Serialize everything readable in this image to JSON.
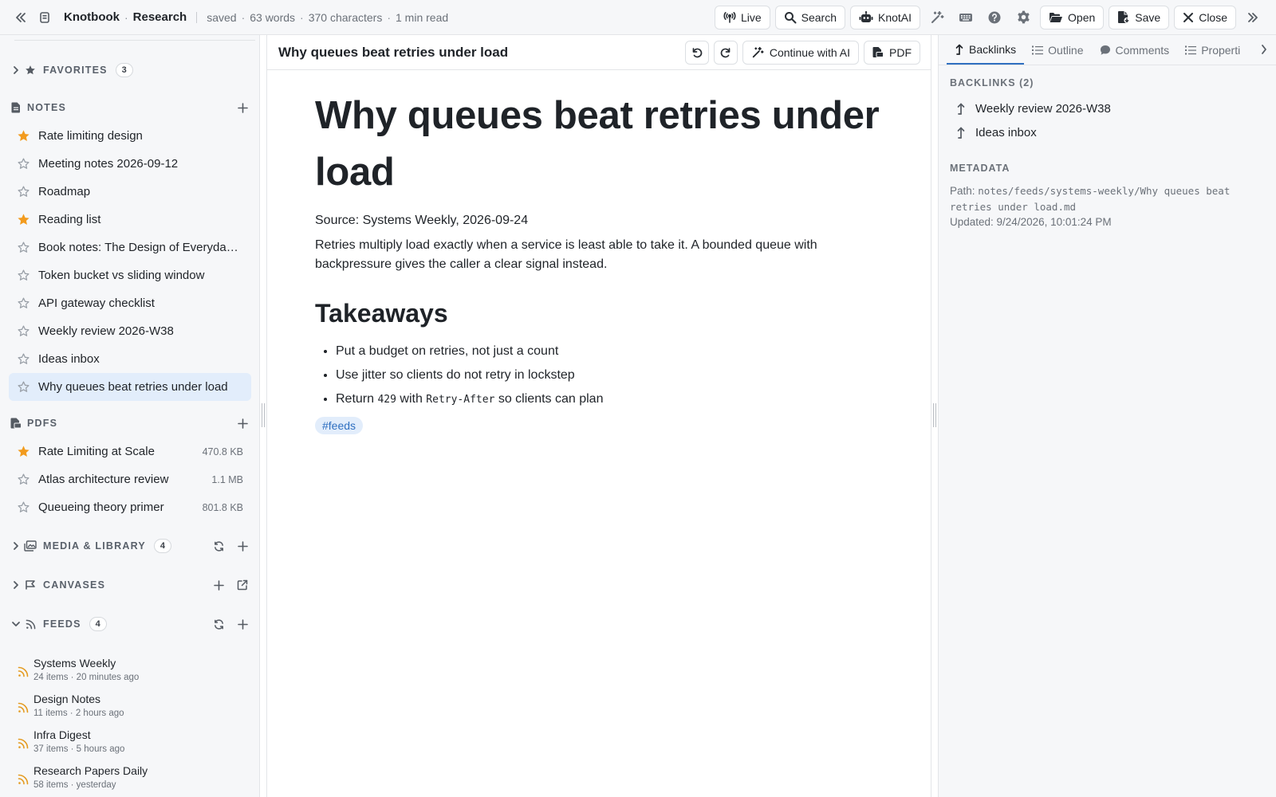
{
  "topbar": {
    "app_name": "Knotbook",
    "vault_name": "Research",
    "separator": "·",
    "save_status": "saved",
    "words": "63 words",
    "characters": "370 characters",
    "read_time": "1 min read",
    "buttons": {
      "live": "Live",
      "search": "Search",
      "knotai": "KnotAI",
      "open": "Open",
      "save": "Save",
      "close": "Close"
    }
  },
  "sidebar": {
    "favorites": {
      "title": "FAVORITES",
      "count": "3"
    },
    "notes": {
      "title": "NOTES",
      "items": [
        {
          "label": "Rate limiting design",
          "starred": true
        },
        {
          "label": "Meeting notes 2026-09-12",
          "starred": false
        },
        {
          "label": "Roadmap",
          "starred": false
        },
        {
          "label": "Reading list",
          "starred": true
        },
        {
          "label": "Book notes: The Design of Everyday ...",
          "starred": false
        },
        {
          "label": "Token bucket vs sliding window",
          "starred": false
        },
        {
          "label": "API gateway checklist",
          "starred": false
        },
        {
          "label": "Weekly review 2026-W38",
          "starred": false
        },
        {
          "label": "Ideas inbox",
          "starred": false
        },
        {
          "label": "Why queues beat retries under load",
          "starred": false,
          "active": true
        }
      ]
    },
    "pdfs": {
      "title": "PDFS",
      "items": [
        {
          "label": "Rate Limiting at Scale",
          "size": "470.8 KB",
          "starred": true
        },
        {
          "label": "Atlas architecture review",
          "size": "1.1 MB",
          "starred": false
        },
        {
          "label": "Queueing theory primer",
          "size": "801.8 KB",
          "starred": false
        }
      ]
    },
    "media": {
      "title": "MEDIA & LIBRARY",
      "count": "4"
    },
    "canvases": {
      "title": "CANVASES"
    },
    "feeds": {
      "title": "FEEDS",
      "count": "4",
      "items": [
        {
          "name": "Systems Weekly",
          "meta": "24 items · 20 minutes ago"
        },
        {
          "name": "Design Notes",
          "meta": "11 items · 2 hours ago"
        },
        {
          "name": "Infra Digest",
          "meta": "37 items · 5 hours ago"
        },
        {
          "name": "Research Papers Daily",
          "meta": "58 items · yesterday"
        }
      ]
    }
  },
  "editor": {
    "header_title": "Why queues beat retries under load",
    "continue_ai": "Continue with AI",
    "pdf": "PDF",
    "doc": {
      "h1": "Why queues beat retries under load",
      "source": "Source: Systems Weekly, 2026-09-24",
      "paragraph": "Retries multiply load exactly when a service is least able to take it. A bounded queue with backpressure gives the caller a clear signal instead.",
      "h2": "Takeaways",
      "bullets": {
        "b1": "Put a budget on retries, not just a count",
        "b2": "Use jitter so clients do not retry in lockstep",
        "b3_pre": "Return ",
        "b3_code1": "429",
        "b3_mid": " with ",
        "b3_code2": "Retry-After",
        "b3_post": " so clients can plan"
      },
      "tag": "#feeds"
    }
  },
  "right_panel": {
    "tabs": {
      "backlinks": "Backlinks",
      "outline": "Outline",
      "comments": "Comments",
      "properties": "Properti"
    },
    "backlinks_heading": "BACKLINKS (2)",
    "backlinks": [
      "Weekly review 2026-W38",
      "Ideas inbox"
    ],
    "metadata_heading": "METADATA",
    "path_label": "Path: ",
    "path_value": "notes/feeds/systems-weekly/Why queues beat retries under load.md",
    "updated": "Updated: 9/24/2026, 10:01:24 PM"
  },
  "colors": {
    "accent": "#2f6fc0",
    "star_filled": "#f29b1e",
    "feed_icon": "#e49a1f",
    "active_bg": "#e2edfb"
  }
}
